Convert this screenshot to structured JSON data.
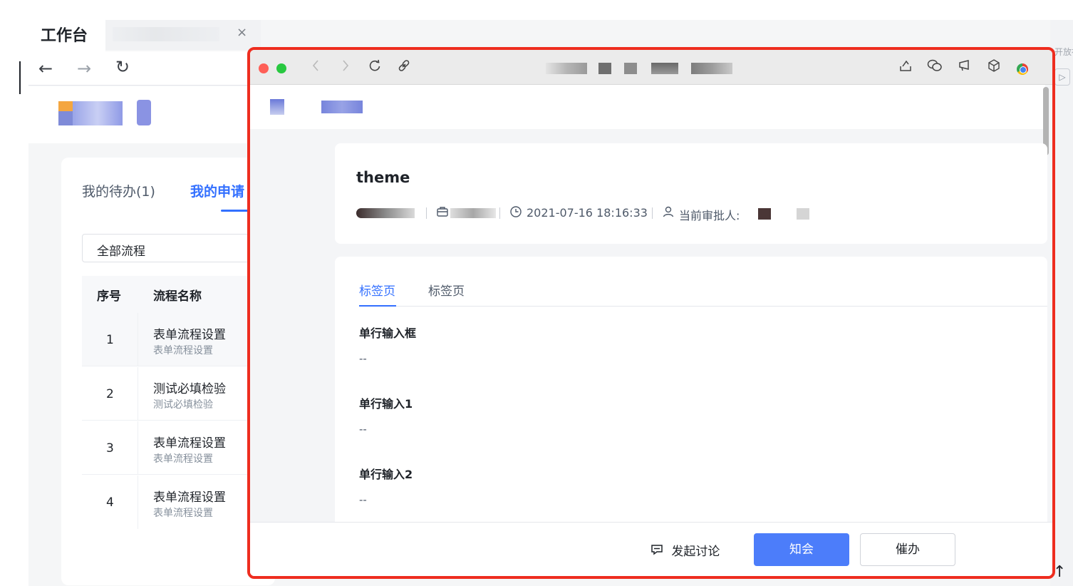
{
  "background_app": {
    "tab_title": "工作台",
    "tab_close": "×",
    "nav": {
      "back": "←",
      "forward": "→",
      "reload": "↻"
    },
    "tabs": [
      {
        "label": "我的待办(1)"
      },
      {
        "label": "我的申请"
      }
    ],
    "filter_select": "全部流程",
    "table": {
      "headers": [
        "序号",
        "流程名称"
      ],
      "rows": [
        {
          "num": "1",
          "title": "表单流程设置",
          "sub": "表单流程设置"
        },
        {
          "num": "2",
          "title": "测试必填检验",
          "sub": "测试必填检验"
        },
        {
          "num": "3",
          "title": "表单流程设置",
          "sub": "表单流程设置"
        },
        {
          "num": "4",
          "title": "表单流程设置",
          "sub": "表单流程设置"
        }
      ]
    },
    "right_strip_text": "开放社",
    "right_strip_btn": "▷",
    "scroll_top_icon": "↑"
  },
  "browser": {
    "toolbar_icons": [
      "chevron-left-icon",
      "chevron-right-icon",
      "refresh-icon",
      "link-icon",
      "share-icon",
      "wechat-icon",
      "cast-icon",
      "cube-icon",
      "chrome-icon"
    ],
    "document": {
      "title": "theme",
      "timestamp": "2021-07-16 18:16:33",
      "approver_label": "当前审批人:"
    },
    "form_tabs": [
      {
        "label": "标签页"
      },
      {
        "label": "标签页"
      }
    ],
    "fields": [
      {
        "label": "单行输入框",
        "value": "--"
      },
      {
        "label": "单行输入1",
        "value": "--"
      },
      {
        "label": "单行输入2",
        "value": "--"
      }
    ],
    "footer": {
      "discuss": "发起讨论",
      "primary_button": "知会",
      "secondary_button": "催办"
    }
  },
  "colors": {
    "accent": "#3370ff",
    "primary_button": "#4c7dfa",
    "highlight_border": "#ee2d1f"
  }
}
